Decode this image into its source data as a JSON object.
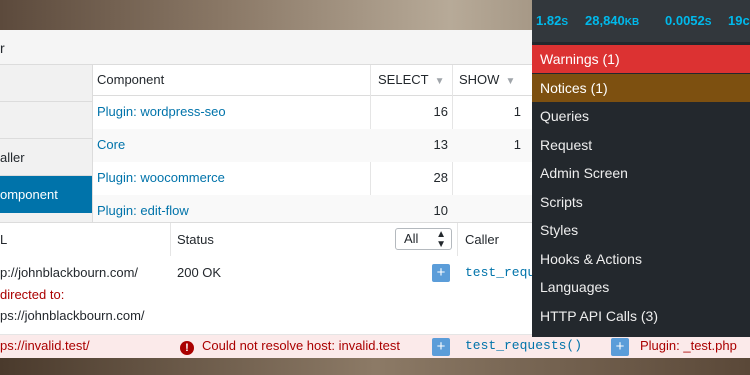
{
  "panel": {
    "title": "r"
  },
  "sidebar": {
    "items": [
      {
        "label": "aller"
      },
      {
        "label": "omponent"
      }
    ]
  },
  "components_table": {
    "columns": [
      {
        "label": "Component"
      },
      {
        "label": "SELECT"
      },
      {
        "label": "SHOW"
      }
    ],
    "rows": [
      {
        "component": "Plugin: wordpress-seo",
        "select": "16",
        "show": "1"
      },
      {
        "component": "Core",
        "select": "13",
        "show": "1"
      },
      {
        "component": "Plugin: woocommerce",
        "select": "28",
        "show": ""
      },
      {
        "component": "Plugin: edit-flow",
        "select": "10",
        "show": ""
      }
    ]
  },
  "http_table": {
    "columns": {
      "url": "L",
      "status": "Status",
      "caller": "Caller"
    },
    "filter": {
      "value": "All"
    },
    "rows": [
      {
        "url_line1": "p://johnblackbourn.com/",
        "url_line2": "directed to:",
        "url_line3": "ps://johnblackbourn.com/",
        "status": "200 OK",
        "caller": "test_reques"
      },
      {
        "url": "ps://invalid.test/",
        "status": "Could not resolve host: invalid.test",
        "caller": "test_requests()",
        "component": "Plugin: _test.php"
      }
    ]
  },
  "menu": {
    "stats": {
      "time": "1.82",
      "time_unit": "S",
      "memory": "28,840",
      "memory_unit": "KB",
      "query_time": "0.0052",
      "query_time_unit": "S",
      "queries": "19c"
    },
    "items": [
      {
        "label": "Warnings (1)"
      },
      {
        "label": "Notices (1)"
      },
      {
        "label": "Queries"
      },
      {
        "label": "Request"
      },
      {
        "label": "Admin Screen"
      },
      {
        "label": "Scripts"
      },
      {
        "label": "Styles"
      },
      {
        "label": "Hooks & Actions"
      },
      {
        "label": "Languages"
      },
      {
        "label": "HTTP API Calls (3)"
      }
    ]
  },
  "colors": {
    "accent": "#0073aa",
    "warning": "#dc3232",
    "notice": "#7d5010",
    "menu_bg": "#23282d",
    "stat_text": "#00b9eb",
    "error_row": "#fbeaea"
  }
}
